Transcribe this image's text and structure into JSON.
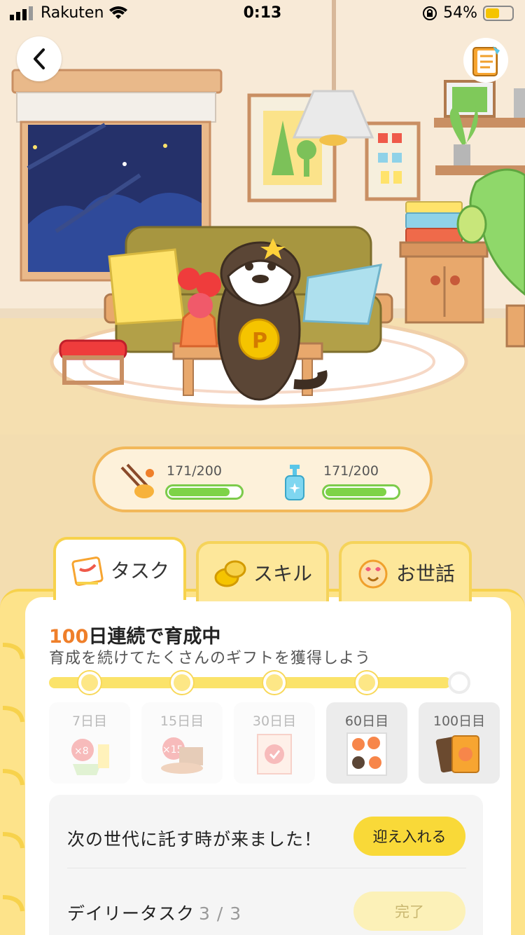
{
  "status_bar": {
    "carrier": "Rakuten",
    "time": "0:13",
    "battery": "54%",
    "battery_level": 0.54
  },
  "icons": {
    "back": "chevron-left-icon",
    "notebook": "notebook-icon",
    "food": "food-icon",
    "soap": "soap-bottle-icon"
  },
  "gauges": {
    "food": {
      "label": "171/200",
      "value": 171,
      "max": 200
    },
    "clean": {
      "label": "171/200",
      "value": 171,
      "max": 200
    }
  },
  "tabs": [
    {
      "label": "タスク",
      "active": true
    },
    {
      "label": "スキル",
      "active": false
    },
    {
      "label": "お世話",
      "active": false
    }
  ],
  "streak": {
    "days": "100",
    "title_rest": "日連続で育成中",
    "subtitle": "育成を続けてたくさんのギフトを獲得しよう"
  },
  "milestones": [
    {
      "label": "7日目",
      "badge": "×8"
    },
    {
      "label": "15日目",
      "badge": "×15"
    },
    {
      "label": "30日目"
    },
    {
      "label": "60日目"
    },
    {
      "label": "100日目"
    }
  ],
  "tasks": {
    "next_gen_text": "次の世代に託す時が来ました！",
    "welcome_button": "迎え入れる",
    "daily_label": "デイリータスク",
    "daily_count": "3 / 3",
    "done_button": "完了"
  },
  "colors": {
    "accent_yellow": "#f9d938",
    "accent_orange": "#ef7f2a",
    "gauge_green": "#7ed348"
  }
}
